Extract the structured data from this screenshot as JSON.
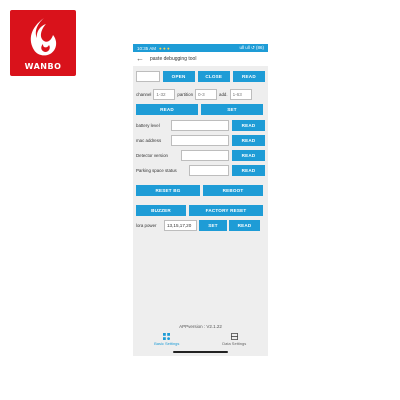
{
  "brand": {
    "name": "WANBO",
    "color": "#d9121b"
  },
  "status_bar": {
    "time": "10:35 AM",
    "indicators": "● ● ●",
    "right": "ull ull ↺ (86)"
  },
  "app_bar": {
    "title": "paste debugging tool"
  },
  "connection": {
    "port_value": "",
    "open_label": "OPEN",
    "close_label": "CLOSE",
    "read_label": "READ"
  },
  "params": {
    "channel_label": "channel",
    "channel_placeholder": "1-32",
    "partition_label": "partition",
    "partition_placeholder": "0-3",
    "add_label": "add.",
    "add_placeholder": "1-63",
    "read_label": "READ",
    "set_label": "SET"
  },
  "fields": [
    {
      "label": "battery level",
      "value": "",
      "button": "READ"
    },
    {
      "label": "mac address",
      "value": "",
      "button": "READ"
    },
    {
      "label": "Detector version",
      "value": "",
      "button": "READ"
    },
    {
      "label": "Parking space status",
      "value": "",
      "button": "READ"
    }
  ],
  "actions": {
    "reset_bg": "RESET BG",
    "reboot": "REBOOT",
    "buzzer": "BUZZER",
    "factory_reset": "FACTORY RESET"
  },
  "lora": {
    "label": "lora power",
    "value": "13,15,17,20",
    "set_label": "SET",
    "read_label": "READ"
  },
  "footer": {
    "version": "APPversion : V2.1.22"
  },
  "nav": {
    "basic": "Basic Settings",
    "data": "Data Settings"
  },
  "colors": {
    "accent": "#1e9cd6",
    "background": "#eeeeee"
  }
}
